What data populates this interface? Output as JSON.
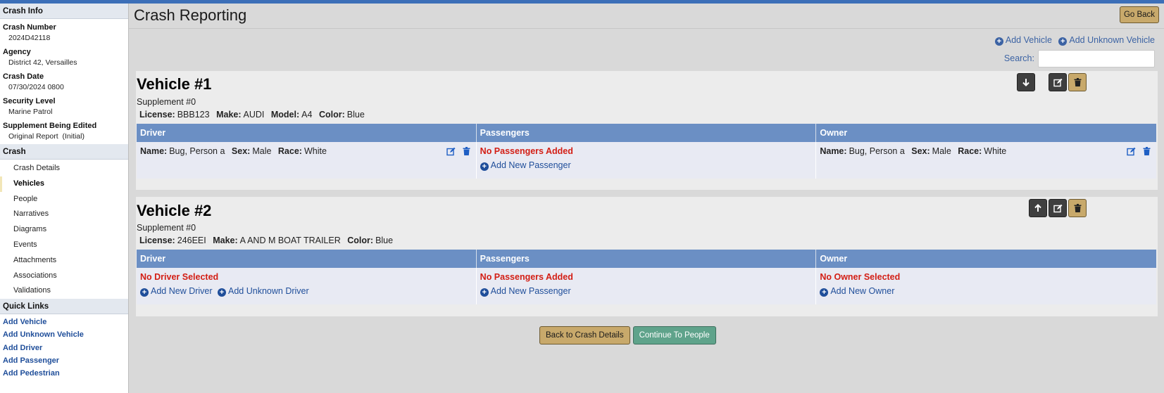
{
  "sidebar": {
    "crash_info": {
      "header": "Crash Info",
      "fields": [
        {
          "label": "Crash Number",
          "value": "2024D42118"
        },
        {
          "label": "Agency",
          "value": "District 42, Versailles"
        },
        {
          "label": "Crash Date",
          "value": "07/30/2024 0800"
        },
        {
          "label": "Security Level",
          "value": "Marine Patrol"
        },
        {
          "label": "Supplement Being Edited",
          "value": "Original Report  (Initial)"
        }
      ]
    },
    "crash": {
      "header": "Crash",
      "items": [
        "Crash Details",
        "Vehicles",
        "People",
        "Narratives",
        "Diagrams",
        "Events",
        "Attachments",
        "Associations",
        "Validations"
      ]
    },
    "quick_links": {
      "header": "Quick Links",
      "items": [
        "Add Vehicle",
        "Add Unknown Vehicle",
        "Add Driver",
        "Add Passenger",
        "Add Pedestrian"
      ]
    }
  },
  "header": {
    "title": "Crash Reporting",
    "go_back": "Go Back"
  },
  "toolbar": {
    "add_vehicle": "Add Vehicle",
    "add_unknown_vehicle": "Add Unknown Vehicle",
    "search_label": "Search:",
    "search_value": ""
  },
  "columns": {
    "driver": "Driver",
    "passengers": "Passengers",
    "owner": "Owner"
  },
  "vehicles": [
    {
      "title": "Vehicle #1",
      "supplement": "Supplement #0",
      "license_label": "License:",
      "license": "BBB123",
      "make_label": "Make:",
      "make": "AUDI",
      "model_label": "Model:",
      "model": "A4",
      "color_label": "Color:",
      "color": "Blue",
      "driver": {
        "name_label": "Name:",
        "name": "Bug, Person a",
        "sex_label": "Sex:",
        "sex": "Male",
        "race_label": "Race:",
        "race": "White"
      },
      "passengers": {
        "none": "No Passengers Added",
        "add": "Add New Passenger"
      },
      "owner": {
        "name_label": "Name:",
        "name": "Bug, Person a",
        "sex_label": "Sex:",
        "sex": "Male",
        "race_label": "Race:",
        "race": "White"
      }
    },
    {
      "title": "Vehicle #2",
      "supplement": "Supplement #0",
      "license_label": "License:",
      "license": "246EEI",
      "make_label": "Make:",
      "make": "A AND M BOAT TRAILER",
      "color_label": "Color:",
      "color": "Blue",
      "driver": {
        "none": "No Driver Selected",
        "add": "Add New Driver",
        "add_unknown": "Add Unknown Driver"
      },
      "passengers": {
        "none": "No Passengers Added",
        "add": "Add New Passenger"
      },
      "owner": {
        "none": "No Owner Selected",
        "add": "Add New Owner"
      }
    }
  ],
  "footer": {
    "back": "Back to Crash Details",
    "continue": "Continue To People"
  },
  "colors": {
    "accent_blue": "#3c6fb8",
    "table_header": "#6b8fc4",
    "gold_button": "#c8a96b",
    "green_button": "#5fa38b",
    "alert_red": "#d31e14"
  }
}
